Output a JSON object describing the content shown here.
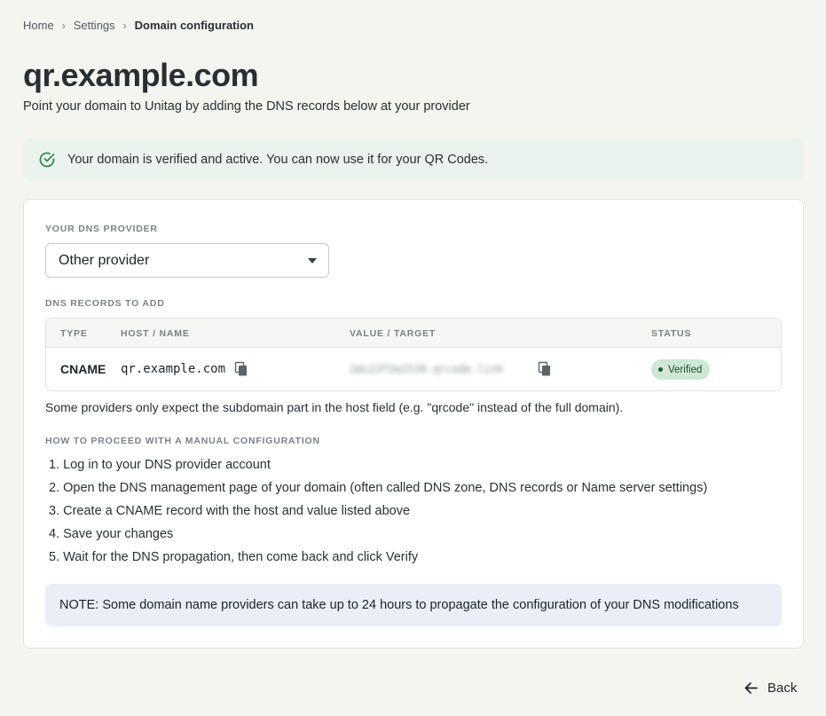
{
  "breadcrumb": {
    "items": [
      "Home",
      "Settings",
      "Domain configuration"
    ]
  },
  "page": {
    "title": "qr.example.com",
    "subtitle": "Point your domain to Unitag by adding the DNS records below at your provider"
  },
  "banner": {
    "text": "Your domain is verified and active. You can now use it for your QR Codes.",
    "icon": "check-circle-icon",
    "color": "#2e8b57"
  },
  "provider": {
    "label": "YOUR DNS PROVIDER",
    "selected": "Other provider"
  },
  "records": {
    "label": "DNS RECORDS TO ADD",
    "columns": [
      "TYPE",
      "HOST / NAME",
      "VALUE / TARGET",
      "STATUS"
    ],
    "rows": [
      {
        "type": "CNAME",
        "host": "qr.example.com",
        "value": "3dc23f3a1539.qrcode.link",
        "status": "Verified"
      }
    ]
  },
  "hint": "Some providers only expect the subdomain part in the host field (e.g. \"qrcode\" instead of the full domain).",
  "manual": {
    "label": "HOW TO PROCEED WITH A MANUAL CONFIGURATION",
    "steps": [
      "1. Log in to your DNS provider account",
      "2. Open the DNS management page of your domain (often called DNS zone, DNS records or Name server settings)",
      "3. Create a CNAME record with the host and value listed above",
      "4. Save your changes",
      "5. Wait for the DNS propagation, then come back and click Verify"
    ]
  },
  "note": "NOTE: Some domain name providers can take up to 24 hours to propagate the configuration of your DNS modifications",
  "back_label": "Back",
  "colors": {
    "success_bg": "#eaf3ee",
    "badge_bg": "#cfe7d5",
    "note_bg": "#ebeef7",
    "page_bg": "#f4f4f0"
  }
}
